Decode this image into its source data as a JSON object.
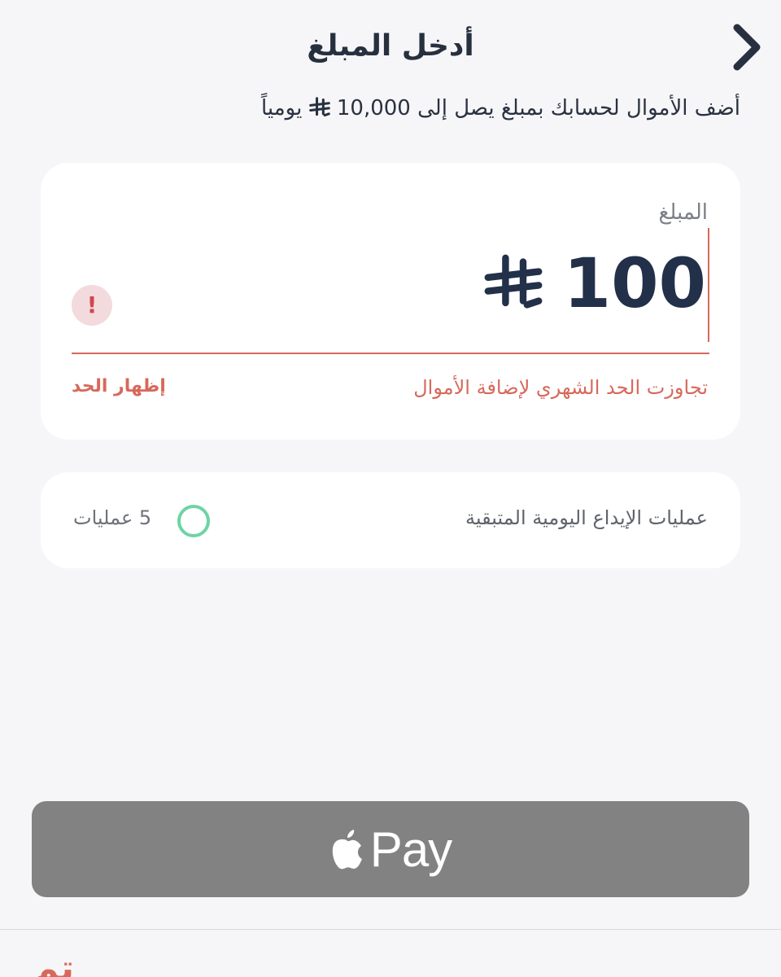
{
  "header": {
    "title": "أدخل المبلغ",
    "back_icon": "chevron-right-icon"
  },
  "subtitle": {
    "before": "أضف الأموال لحسابك بمبلغ يصل إلى 10,000",
    "after": "يومياً",
    "currency_icon": "riyal-icon"
  },
  "amount_card": {
    "label": "المبلغ",
    "value": "100",
    "currency_icon": "riyal-icon",
    "error_icon_glyph": "!",
    "error_message": "تجاوزت الحد الشهري لإضافة الأموال",
    "show_limit_label": "إظهار الحد"
  },
  "operations_card": {
    "label": "عمليات الإيداع اليومية المتبقية",
    "count": "5 عمليات"
  },
  "payment": {
    "apple_pay_label": "Pay",
    "logo_icon": "apple-icon"
  },
  "bottom": {
    "done_label": "تم"
  },
  "colors": {
    "background": "#f6f6f8",
    "card": "#ffffff",
    "primary_text": "#27303f",
    "error": "#d7695b",
    "ring": "#6fd3a5",
    "apple_pay_button": "#828282"
  }
}
